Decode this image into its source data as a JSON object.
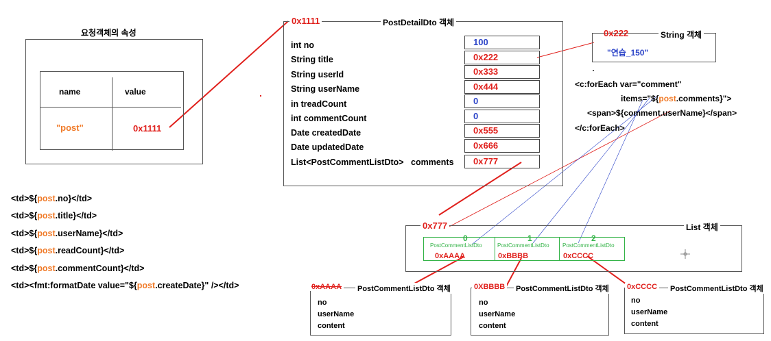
{
  "request_attr": {
    "title": "요청객체의 속성",
    "col_name": "name",
    "col_value": "value",
    "name": "\"post\"",
    "value": "0x1111"
  },
  "dto": {
    "address": "0x1111",
    "title": "PostDetailDto 객체",
    "fields": [
      {
        "label": "int no",
        "value": "100"
      },
      {
        "label": "String title",
        "value": "0x222"
      },
      {
        "label": "String userId",
        "value": "0x333"
      },
      {
        "label": "String userName",
        "value": "0x444"
      },
      {
        "label": "in treadCount",
        "value": "0"
      },
      {
        "label": "int commentCount",
        "value": "0"
      },
      {
        "label": "Date createdDate",
        "value": "0x555"
      },
      {
        "label": "Date updatedDate",
        "value": "0x666"
      },
      {
        "label": "List<PostCommentListDto>   comments",
        "value": "0x777"
      }
    ]
  },
  "string_obj": {
    "address": "0x222",
    "title": "String 객체",
    "value": "\"연습_150\""
  },
  "foreach_code": {
    "line1": "<c:forEach var=\"comment\"",
    "line2_prefix": "items=\"${",
    "line2_keyword": "post",
    "line2_suffix": ".comments}\">",
    "line3": "<span>${comment.userName}</span>",
    "line4": "</c:forEach>"
  },
  "td_code": [
    {
      "prefix": "<td>${",
      "keyword": "post",
      "suffix": ".no}</td>"
    },
    {
      "prefix": "<td>${",
      "keyword": "post",
      "suffix": ".title}</td>"
    },
    {
      "prefix": "<td>${",
      "keyword": "post",
      "suffix": ".userName}</td>"
    },
    {
      "prefix": "<td>${",
      "keyword": "post",
      "suffix": ".readCount}</td>"
    },
    {
      "prefix": "<td>${",
      "keyword": "post",
      "suffix": ".commentCount}</td>"
    },
    {
      "prefix": "<td><fmt:formatDate value=\"${",
      "keyword": "post",
      "suffix": ".createDate}\" /></td>"
    }
  ],
  "list_obj": {
    "address": "0x777",
    "title": "List 객체",
    "items": [
      {
        "index": "0",
        "type": "PostCommentListDto",
        "address": "0xAAAA"
      },
      {
        "index": "1",
        "type": "PostCommentListDto",
        "address": "0xBBBB"
      },
      {
        "index": "2",
        "type": "PostCommentListDto",
        "address": "0xCCCC"
      }
    ]
  },
  "comment_objs": [
    {
      "address": "0xAAAA",
      "title": "PostCommentListDto 객체",
      "fields": [
        "no",
        "userName",
        "content"
      ]
    },
    {
      "address": "0XBBBB",
      "title": "PostCommentListDto 객체",
      "fields": [
        "no",
        "userName",
        "content"
      ]
    },
    {
      "address": "0xCCCC",
      "title": "PostCommentListDto 객체",
      "fields": [
        "no",
        "userName",
        "content"
      ]
    }
  ],
  "colors": {
    "address_red": "#e0201c",
    "keyword_orange": "#f07a28",
    "number_blue": "#2c44c8",
    "index_green": "#33b347"
  }
}
